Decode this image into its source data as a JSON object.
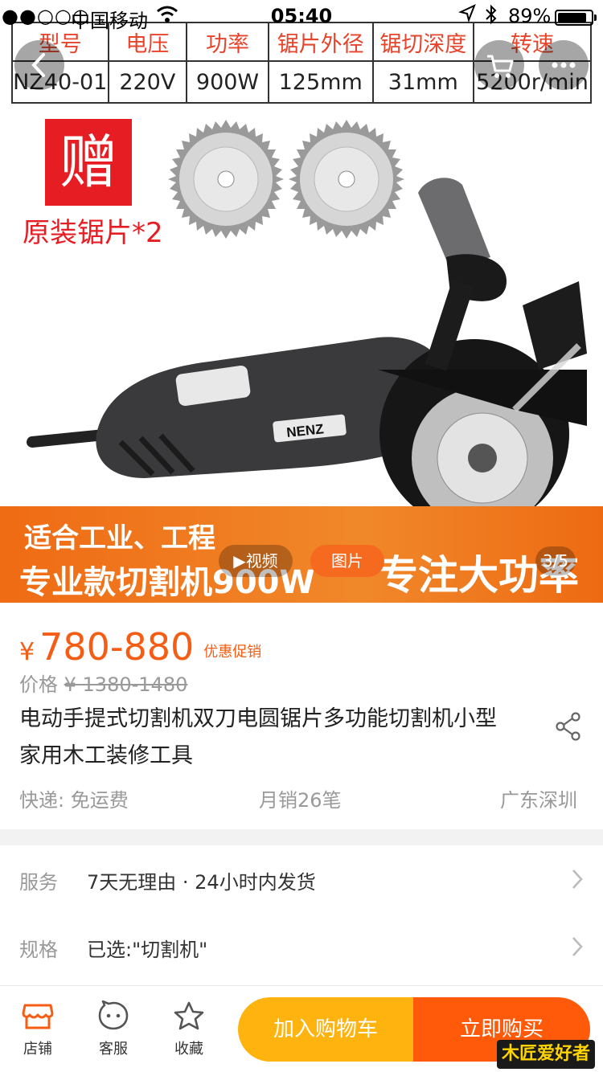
{
  "status_bar": {
    "signal": "●●○○○",
    "carrier": "中国移动",
    "time": "05:40",
    "battery_pct": "89%",
    "battery_level": 0.89
  },
  "hero": {
    "spec_table": {
      "headers": [
        "型号",
        "电压",
        "功率",
        "锯片外径",
        "锯切深度",
        "转速"
      ],
      "values": [
        "NZ40-01",
        "220V",
        "900W",
        "125mm",
        "31mm",
        "5200r/min"
      ]
    },
    "gift_badge": "赠",
    "gift_text": "原装锯片*2",
    "brand": "NENZ",
    "banner_line1": "适合工业、工程",
    "banner_line2": "专业款切割机900W",
    "banner_right": "专注大功率",
    "video_label": "视频",
    "image_label": "图片",
    "counter": "3/5"
  },
  "product": {
    "currency": "¥",
    "price": "780-880",
    "promo": "优惠促销",
    "orig_label": "价格",
    "orig_price": "¥ 1380-1480",
    "title": "电动手提式切割机双刀电圆锯片多功能切割机小型家用木工装修工具",
    "shipping": "快递: 免运费",
    "monthly_sales": "月销26笔",
    "location": "广东深圳"
  },
  "service_row": {
    "label": "服务",
    "value": "7天无理由 · 24小时内发货"
  },
  "spec_row": {
    "label": "规格",
    "value": "已选:\"切割机\""
  },
  "tabbar": {
    "shop": "店铺",
    "service": "客服",
    "favorite": "收藏",
    "add_cart": "加入购物车",
    "buy_now": "立即购买"
  },
  "watermark": "木匠爱好者",
  "colors": {
    "accent": "#f55d14",
    "cart": "#ffb30f",
    "buy": "#ff5a0a",
    "banner": "#ef6b14"
  }
}
